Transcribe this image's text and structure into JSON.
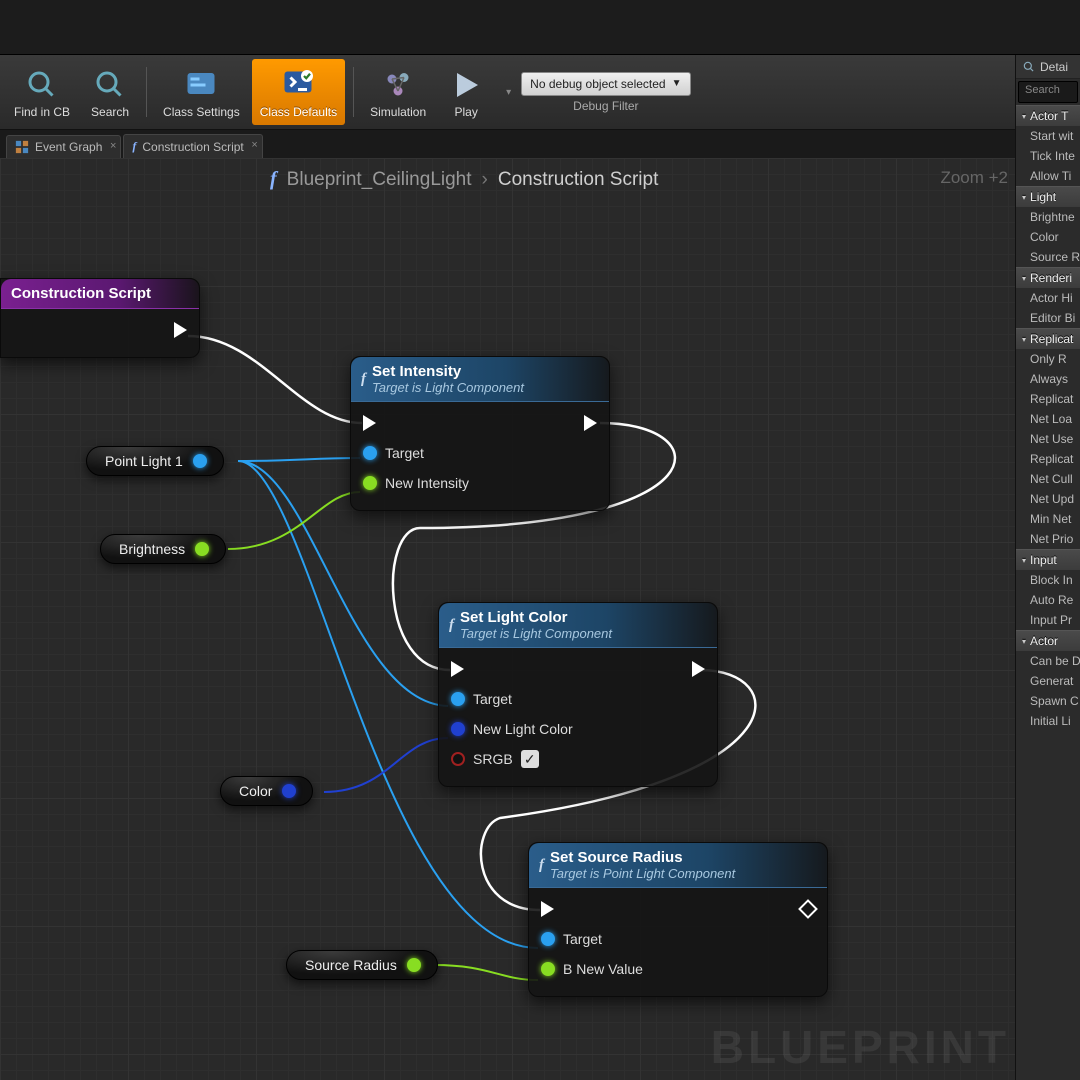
{
  "toolbar": {
    "find_in_cb": "Find in CB",
    "search": "Search",
    "class_settings": "Class Settings",
    "class_defaults": "Class Defaults",
    "simulation": "Simulation",
    "play": "Play",
    "debug_selected": "No debug object selected",
    "debug_filter": "Debug Filter"
  },
  "tabs": {
    "event_graph": "Event Graph",
    "construction_script": "Construction Script"
  },
  "breadcrumb": {
    "asset": "Blueprint_CeilingLight",
    "func": "Construction Script"
  },
  "zoom_label": "Zoom +2",
  "watermark": "BLUEPRINT",
  "details": {
    "title": "Detai",
    "search_ph": "Search",
    "cats": [
      {
        "name": "Actor T",
        "props": [
          "Start wit",
          "Tick Inte",
          "Allow Ti"
        ]
      },
      {
        "name": "Light",
        "props": [
          "Brightne",
          "Color",
          "Source R"
        ]
      },
      {
        "name": "Renderi",
        "props": [
          "Actor Hi",
          "Editor Bi"
        ]
      },
      {
        "name": "Replicat",
        "props": [
          "Only R",
          "Always",
          "Replicat",
          "Net Loa",
          "Net Use",
          "Replicat",
          "Net Cull",
          "Net Upd",
          "Min Net",
          "Net Prio"
        ]
      },
      {
        "name": "Input",
        "props": [
          "Block In",
          "Auto Re",
          "Input Pr"
        ]
      },
      {
        "name": "Actor",
        "props": [
          "Can be D",
          "Generat",
          "Spawn C",
          "Initial Li"
        ]
      }
    ]
  },
  "nodes": {
    "cs": {
      "title": "Construction Script"
    },
    "set_intensity": {
      "title": "Set Intensity",
      "sub": "Target is Light Component",
      "p_target": "Target",
      "p_new": "New Intensity"
    },
    "set_color": {
      "title": "Set Light Color",
      "sub": "Target is Light Component",
      "p_target": "Target",
      "p_color": "New Light Color",
      "p_srgb": "SRGB"
    },
    "set_radius": {
      "title": "Set Source Radius",
      "sub": "Target is Point Light Component",
      "p_target": "Target",
      "p_val": "B New Value"
    }
  },
  "pills": {
    "pointlight": "Point Light 1",
    "brightness": "Brightness",
    "color": "Color",
    "source_radius": "Source Radius"
  }
}
